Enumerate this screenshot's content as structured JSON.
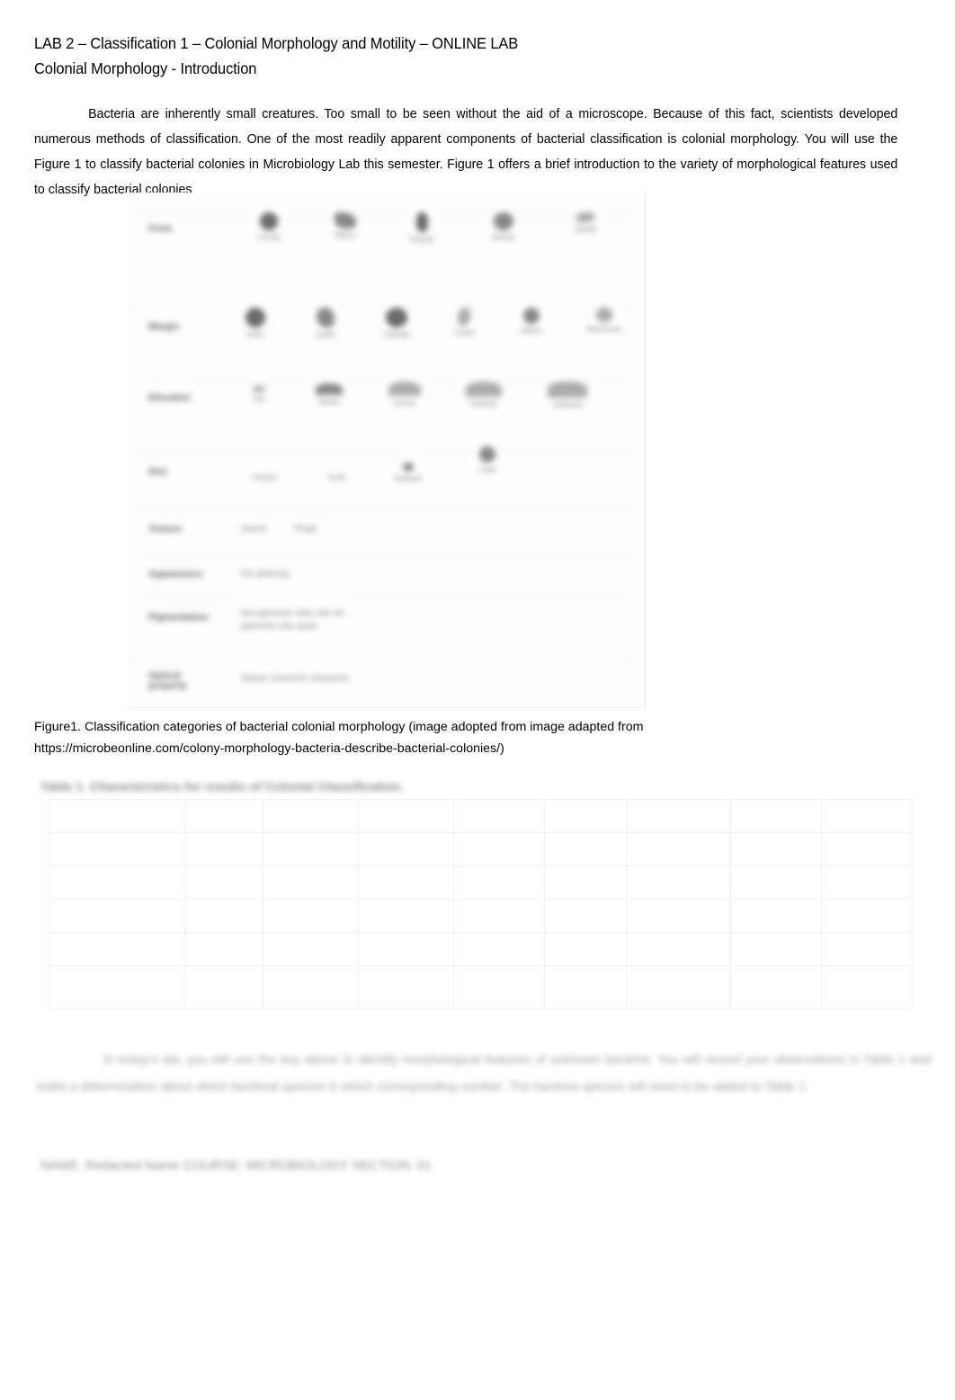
{
  "document": {
    "title_line_1": "LAB 2 – Classification 1 – Colonial Morphology and Motility – ONLINE LAB",
    "title_line_2": "Colonial Morphology - Introduction",
    "intro_paragraph": "Bacteria are inherently small creatures.  Too small to be seen without the aid of a microscope.  Because of this fact, scientists developed numerous methods of classification.  One of the most readily apparent components of bacterial classification is colonial morphology.  You will use the Figure 1 to classify bacterial colonies in Microbiology Lab this semester. Figure 1 offers a brief introduction to the variety of morphological features used to classify bacterial colonies",
    "figure_caption_line_1": "Figure1.  Classification  categories  of  bacterial  colonial  morphology  (image  adopted  from  image   adapted  from",
    "figure_caption_line_2": "https://microbeonline.com/colony-morphology-bacteria-describe-bacterial-colonies/)"
  },
  "figure": {
    "alt": "Classification categories of bacterial colonial morphology chart",
    "rows": [
      {
        "label": "Form",
        "items": [
          "Circular",
          "Filiform",
          "Irregular",
          "Rhizoid",
          "Spindle"
        ]
      },
      {
        "label": "Margin",
        "items": [
          "Entire",
          "Lobate",
          "Undulate",
          "Curled",
          "Filiform",
          "Filamentous"
        ]
      },
      {
        "label": "Elevation",
        "items": [
          "Flat",
          "Raised",
          "Convex",
          "Pulvinate",
          "Umbonate"
        ]
      },
      {
        "label": "Size",
        "items": [
          "Pinpoint",
          "Small",
          "Moderate",
          "Large"
        ]
      },
      {
        "label": "Texture",
        "items": [
          "Smooth",
          "Rough"
        ]
      },
      {
        "label": "Appearance",
        "items": [
          "Dull, glistening"
        ]
      },
      {
        "label": "Pigmentation",
        "items": [
          "Non-pigmented, white, buff, red",
          "pigmented, pink, purple"
        ]
      },
      {
        "label": "Optical property",
        "items": [
          "Opaque, translucent, transparent"
        ]
      }
    ]
  },
  "redacted": {
    "heading_above_table": "Table 1. Characteristics for results of Colonial Classification.",
    "paragraph_below_table": "In today’s lab, you will use the key above to identify morphological features of unknown bacteria.  You will record your observations in Table 1 and make a determination about which bacterial species is which corresponding number.  The bacteria species will need to be added to Table 1.",
    "footer_line": "NAME: Redacted Name          COURSE: MICROBIOLOGY          SECTION: 01"
  },
  "results_table": {
    "column_count": 9,
    "row_count": 6,
    "columns": [
      "",
      "",
      "",
      "",
      "",
      "",
      "",
      "",
      ""
    ],
    "rows": [
      [
        "",
        "",
        "",
        "",
        "",
        "",
        "",
        "",
        ""
      ],
      [
        "",
        "",
        "",
        "",
        "",
        "",
        "",
        "",
        ""
      ],
      [
        "",
        "",
        "",
        "",
        "",
        "",
        "",
        "",
        ""
      ],
      [
        "",
        "",
        "",
        "",
        "",
        "",
        "",
        "",
        ""
      ],
      [
        "",
        "",
        "",
        "",
        "",
        "",
        "",
        "",
        ""
      ],
      [
        "",
        "",
        "",
        "",
        "",
        "",
        "",
        "",
        ""
      ]
    ]
  },
  "colors": {
    "page_background": "#ffffff",
    "text": "#000000",
    "table_gridline": "#f1f1f1",
    "redacted_text": "#4a4a4a"
  }
}
